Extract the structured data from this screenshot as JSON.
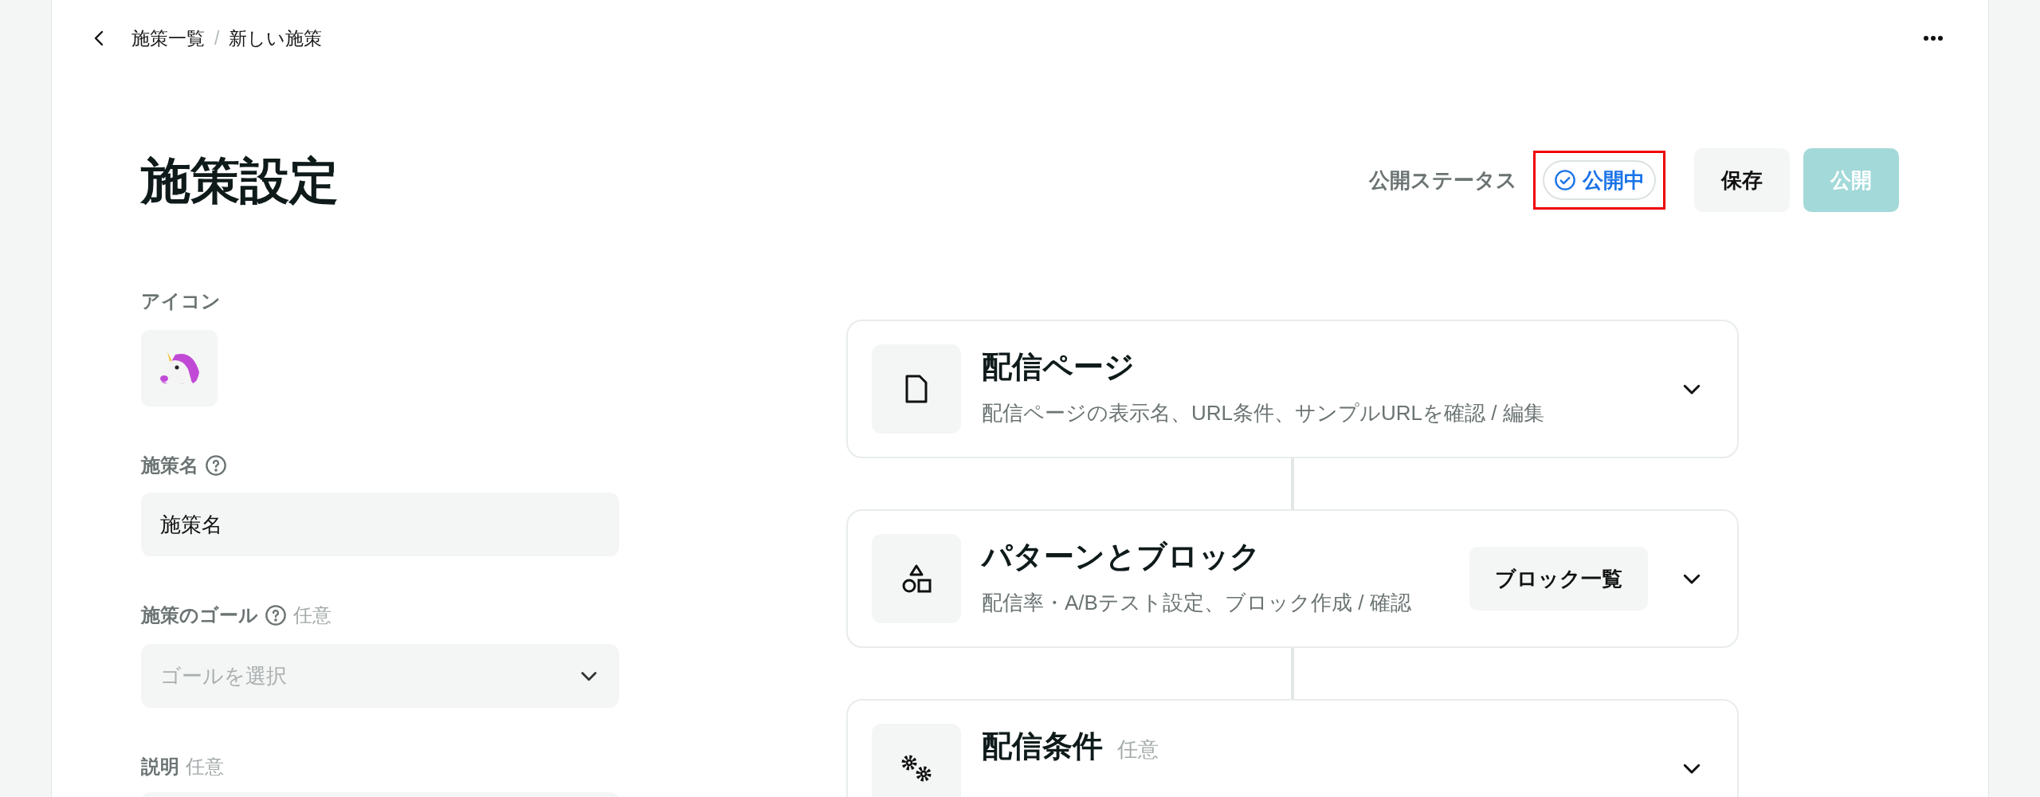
{
  "breadcrumb": {
    "items": [
      "施策一覧",
      "新しい施策"
    ],
    "separator": "/"
  },
  "title": "施策設定",
  "status": {
    "label": "公開ステータス",
    "badge": "公開中",
    "highlighted": true
  },
  "buttons": [
    {
      "label": "保存",
      "kind": "secondary",
      "disabled": false
    },
    {
      "label": "公開",
      "kind": "primary",
      "disabled": true
    }
  ],
  "form": {
    "icon_label": "アイコン",
    "fields": [
      {
        "label": "施策名",
        "help": true,
        "kind": "input",
        "value": "施策名"
      },
      {
        "label": "施策のゴール",
        "help": true,
        "optional": "任意",
        "kind": "select",
        "placeholder": "ゴールを選択"
      },
      {
        "label": "説明",
        "help": false,
        "optional": "任意",
        "kind": "textarea"
      }
    ]
  },
  "sections": [
    {
      "title": "配信ページ",
      "subtitle": "配信ページの表示名、URL条件、サンプルURLを確認 / 編集"
    },
    {
      "title": "パターンとブロック",
      "subtitle": "配信率・A/Bテスト設定、ブロック作成 / 確認",
      "action": "ブロック一覧"
    },
    {
      "title": "配信条件",
      "optional": "任意"
    }
  ]
}
